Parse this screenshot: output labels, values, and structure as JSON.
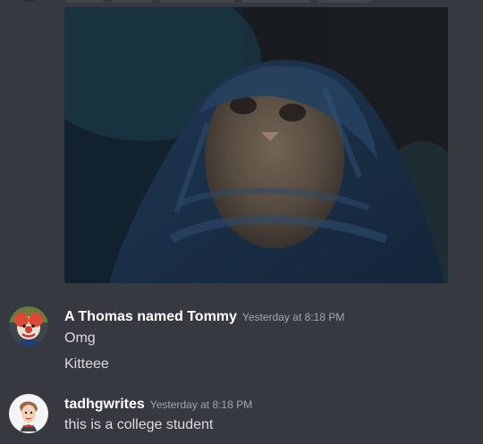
{
  "channel": {
    "background": "#36393f"
  },
  "attachment": {
    "kind": "image",
    "subject": "cat under blanket"
  },
  "messages": [
    {
      "author": "A Thomas named Tommy",
      "timestamp": "Yesterday at 8:18 PM",
      "lines": [
        "Omg",
        "Kitteee"
      ],
      "avatar_icon": "clown-avatar-icon"
    },
    {
      "author": "tadhgwrites",
      "timestamp": "Yesterday at 8:18 PM",
      "lines": [
        "this is a college student"
      ],
      "avatar_icon": "drawn-person-avatar-icon"
    }
  ],
  "colors": {
    "username": "#ffffff",
    "timestamp": "#a3a6aa",
    "message_text": "#dcddde"
  }
}
